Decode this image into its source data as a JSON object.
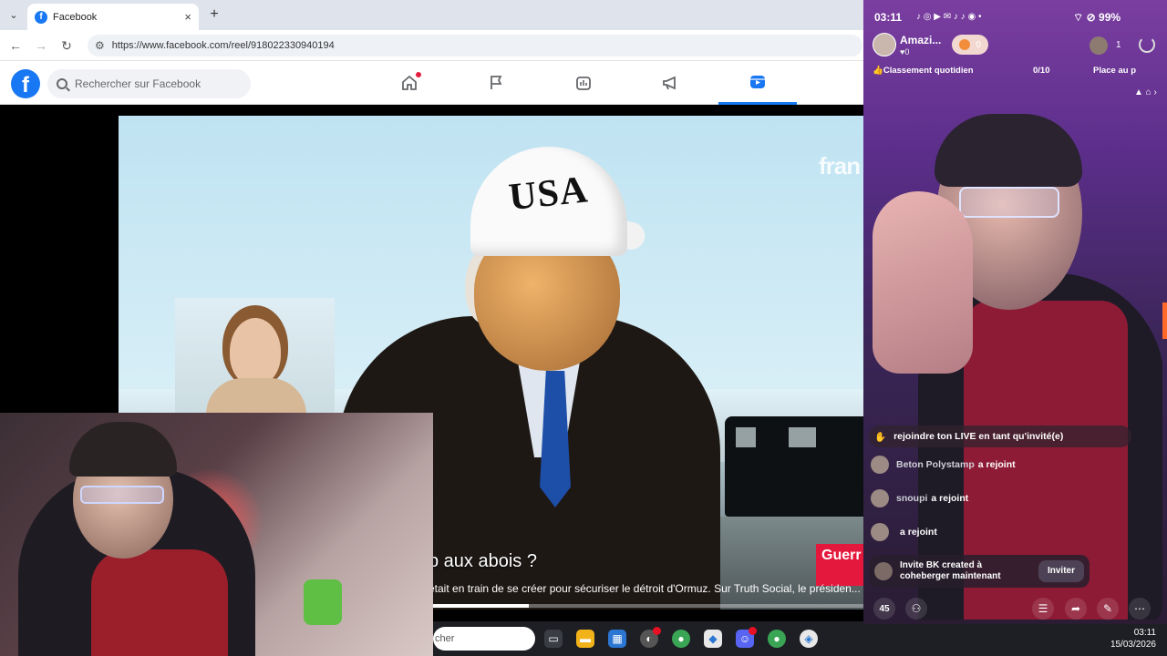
{
  "browser": {
    "tab_title": "Facebook",
    "tab_favicon": "facebook-icon",
    "tab_close": "×",
    "new_tab": "+",
    "url": "https://www.facebook.com/reel/918022330940194"
  },
  "facebook": {
    "search_placeholder": "Rechercher sur Facebook",
    "nav": [
      "home-icon",
      "flag-icon",
      "gaming-icon",
      "megaphone-icon",
      "reels-icon"
    ],
    "active_nav": "reels-icon",
    "accent": "#1877f2"
  },
  "video": {
    "cap_text": "USA",
    "channel_logo": "fran",
    "badge_text": "Guerr Moye",
    "headline": "p aux abois ?",
    "ticker": "était en train de se créer pour sécuriser le détroit d'Ormuz. Sur Truth Social, le présiden...",
    "progress": 0.23
  },
  "taskbar": {
    "search_text": "cher",
    "time": "03:11",
    "date": "15/03/2026"
  },
  "phone": {
    "status_time": "03:11",
    "battery": "99%",
    "host_name": "Amazi...",
    "host_likes": "♥0",
    "follow_count": "0",
    "viewer_count": "1",
    "ranking_label": "Classement quotidien",
    "goal_progress": "0/10",
    "place_label": "Place au p",
    "join_banner": "rejoindre ton LIVE en tant qu'invité(e)",
    "chat": [
      {
        "name": "Beton Polystamp",
        "text": "a rejoint"
      },
      {
        "name": "snoupi",
        "text": "a rejoint"
      },
      {
        "name": "",
        "text": "a rejoint"
      }
    ],
    "invite_text": "Invite BK created à coheberger maintenant",
    "invite_button": "Inviter",
    "bottom_count": "45"
  }
}
